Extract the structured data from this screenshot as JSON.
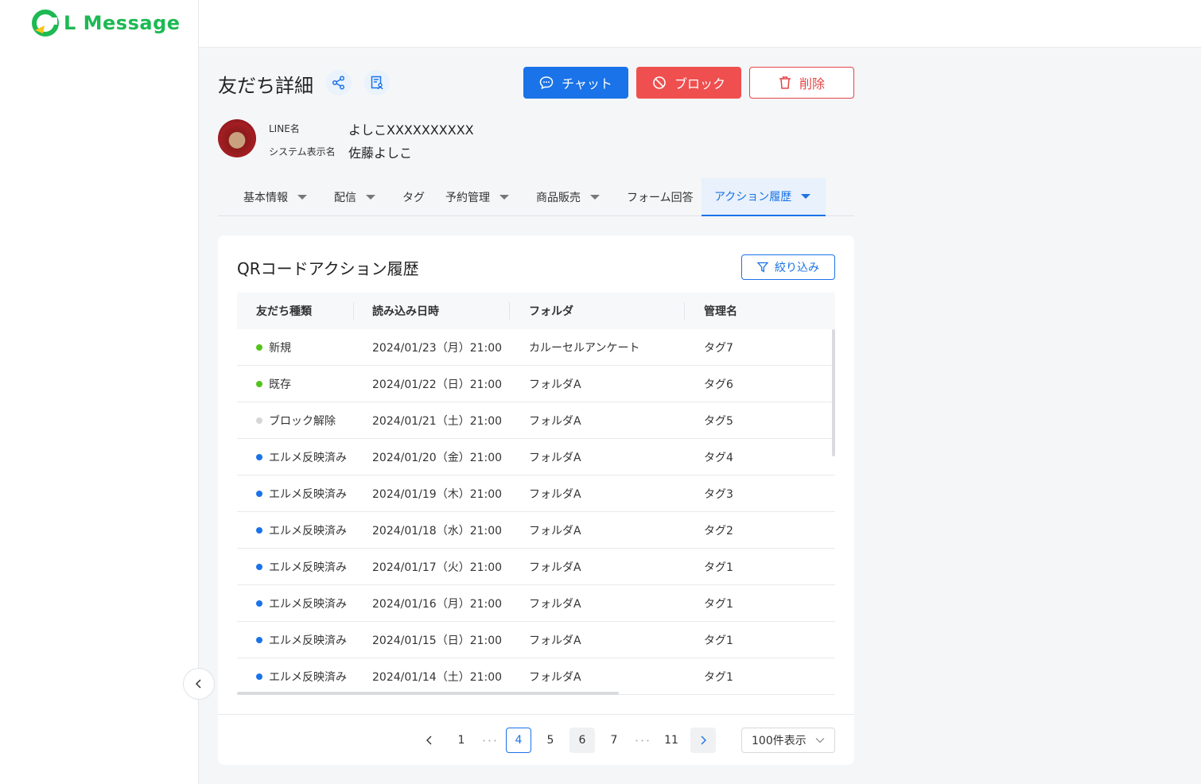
{
  "app": {
    "logo_text": "L Message"
  },
  "header": {
    "title": "友だち詳細",
    "chat_label": "チャット",
    "block_label": "ブロック",
    "delete_label": "削除"
  },
  "profile": {
    "line_name_label": "LINE名",
    "line_name_value": "よしこXXXXXXXXXX",
    "system_name_label": "システム表示名",
    "system_name_value": "佐藤よしこ"
  },
  "tabs": [
    {
      "label": "基本情報",
      "has_dropdown": true
    },
    {
      "label": "配信",
      "has_dropdown": true
    },
    {
      "label": "タグ",
      "has_dropdown": false
    },
    {
      "label": "予約管理",
      "has_dropdown": true
    },
    {
      "label": "商品販売",
      "has_dropdown": true
    },
    {
      "label": "フォーム回答",
      "has_dropdown": false
    },
    {
      "label": "アクション履歴",
      "has_dropdown": true,
      "active": true
    }
  ],
  "card": {
    "title": "QRコードアクション履歴",
    "filter_label": "絞り込み"
  },
  "table": {
    "columns": [
      "友だち種類",
      "読み込み日時",
      "フォルダ",
      "管理名"
    ],
    "rows": [
      {
        "type": "新規",
        "status": "green",
        "datetime": "2024/01/23（月）21:00",
        "folder": "カルーセルアンケート",
        "name": "タグ7"
      },
      {
        "type": "既存",
        "status": "green",
        "datetime": "2024/01/22（日）21:00",
        "folder": "フォルダA",
        "name": "タグ6"
      },
      {
        "type": "ブロック解除",
        "status": "gray",
        "datetime": "2024/01/21（土）21:00",
        "folder": "フォルダA",
        "name": "タグ5"
      },
      {
        "type": "エルメ反映済み",
        "status": "blue",
        "datetime": "2024/01/20（金）21:00",
        "folder": "フォルダA",
        "name": "タグ4"
      },
      {
        "type": "エルメ反映済み",
        "status": "blue",
        "datetime": "2024/01/19（木）21:00",
        "folder": "フォルダA",
        "name": "タグ3"
      },
      {
        "type": "エルメ反映済み",
        "status": "blue",
        "datetime": "2024/01/18（水）21:00",
        "folder": "フォルダA",
        "name": "タグ2"
      },
      {
        "type": "エルメ反映済み",
        "status": "blue",
        "datetime": "2024/01/17（火）21:00",
        "folder": "フォルダA",
        "name": "タグ1"
      },
      {
        "type": "エルメ反映済み",
        "status": "blue",
        "datetime": "2024/01/16（月）21:00",
        "folder": "フォルダA",
        "name": "タグ1"
      },
      {
        "type": "エルメ反映済み",
        "status": "blue",
        "datetime": "2024/01/15（日）21:00",
        "folder": "フォルダA",
        "name": "タグ1"
      },
      {
        "type": "エルメ反映済み",
        "status": "blue",
        "datetime": "2024/01/14（土）21:00",
        "folder": "フォルダA",
        "name": "タグ1"
      }
    ]
  },
  "status_colors": {
    "green": "#52c41a",
    "gray": "#d6d6d6",
    "blue": "#1a73e8"
  },
  "pagination": {
    "pages": [
      "1",
      "4",
      "5",
      "6",
      "7",
      "11"
    ],
    "current": "4",
    "ellipsis": "･･･",
    "page_size_label": "100件表示"
  },
  "colors": {
    "primary": "#1a73e8",
    "danger": "#ef4f4f",
    "brand": "#1db954"
  }
}
